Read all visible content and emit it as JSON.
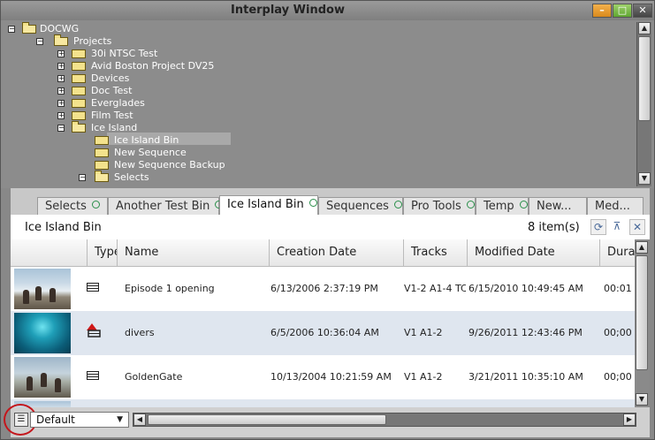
{
  "window": {
    "title": "Interplay Window",
    "buttons": {
      "minimize": "–",
      "maximize": "□",
      "close": "✕"
    }
  },
  "tree": {
    "items": [
      {
        "label": "DOCWG"
      },
      {
        "label": "Projects"
      },
      {
        "label": "30i NTSC Test"
      },
      {
        "label": "Avid Boston Project DV25"
      },
      {
        "label": "Devices"
      },
      {
        "label": "Doc Test"
      },
      {
        "label": "Everglades"
      },
      {
        "label": "Film Test"
      },
      {
        "label": "Ice Island"
      },
      {
        "label": "Ice Island Bin"
      },
      {
        "label": "New Sequence"
      },
      {
        "label": "New Sequence Backup"
      },
      {
        "label": "Selects"
      }
    ]
  },
  "tabs": [
    {
      "label": "Selects"
    },
    {
      "label": "Another Test Bin"
    },
    {
      "label": "Ice Island Bin"
    },
    {
      "label": "Sequences"
    },
    {
      "label": "Pro Tools"
    },
    {
      "label": "Temp"
    },
    {
      "label": "New..."
    },
    {
      "label": "Med..."
    }
  ],
  "bin": {
    "title": "Ice Island Bin",
    "item_count": "8 item(s)"
  },
  "table": {
    "columns": [
      "Type",
      "Name",
      "Creation Date",
      "Tracks",
      "Modified Date",
      "Dura"
    ],
    "rows": [
      {
        "name": "Episode 1 opening",
        "creation": "6/13/2006 2:37:19 PM",
        "tracks": "V1-2 A1-4 TC",
        "modified": "6/15/2010 10:49:45 AM",
        "duration": "00:01"
      },
      {
        "name": "divers",
        "creation": "6/5/2006 10:36:04 AM",
        "tracks": "V1 A1-2",
        "modified": "9/26/2011 12:43:46 PM",
        "duration": "00;00"
      },
      {
        "name": "GoldenGate",
        "creation": "10/13/2004 10:21:59 AM",
        "tracks": "V1 A1-2",
        "modified": "3/21/2011 10:35:10 AM",
        "duration": "00;00"
      }
    ]
  },
  "footer": {
    "view": "Default"
  },
  "colors": {
    "highlight_ring": "#c4161c",
    "tab_dot": "#2a8f4a",
    "alt_row": "#dfe6ef"
  }
}
